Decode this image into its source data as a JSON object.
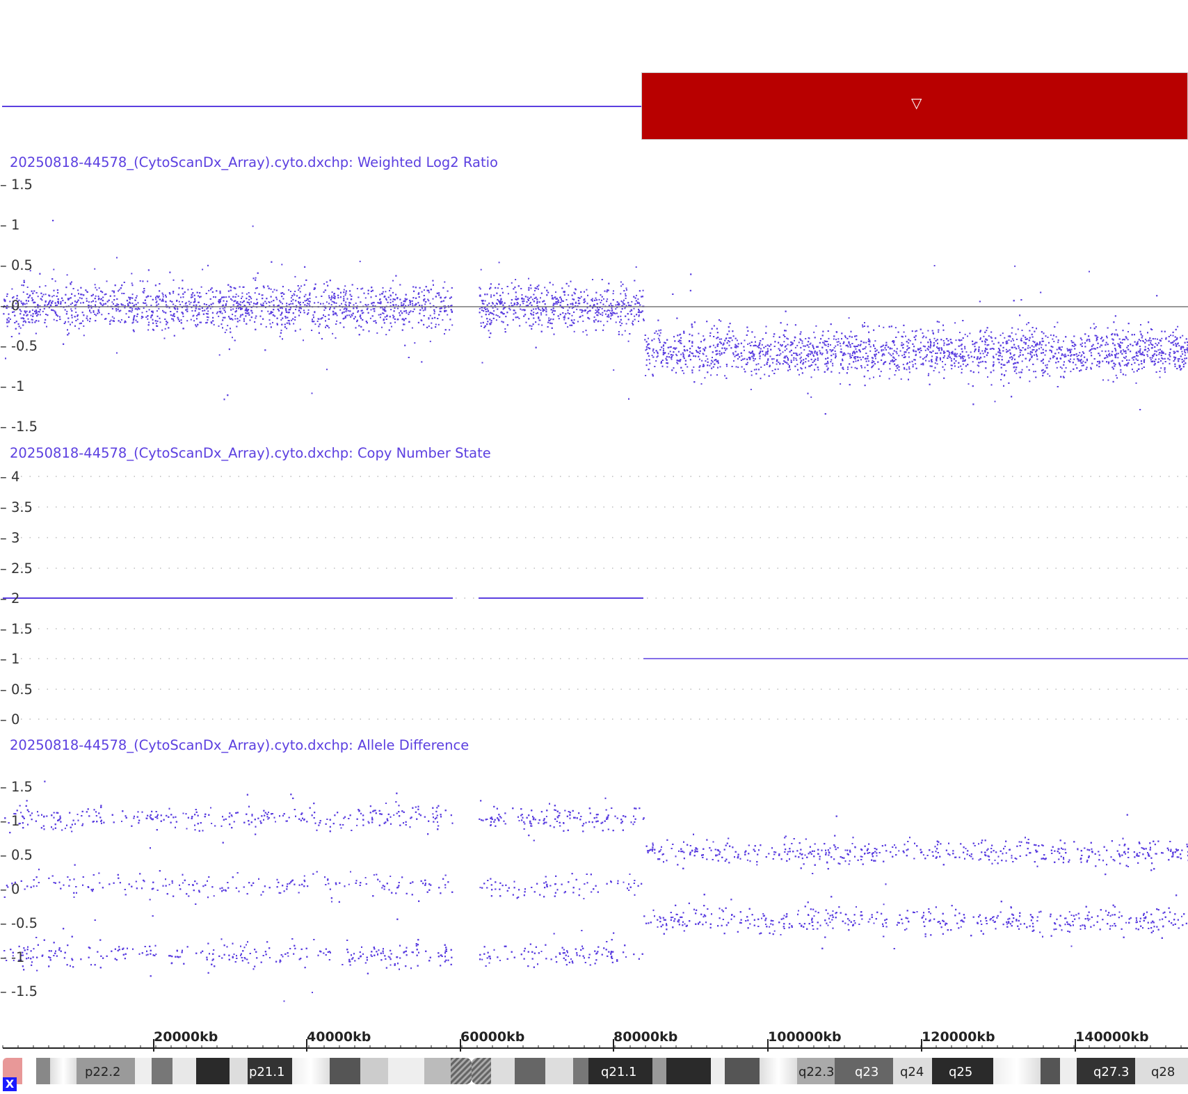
{
  "tracks": {
    "log2": {
      "title": "20250818-44578_(CytoScanDx_Array).cyto.dxchp: Weighted Log2 Ratio",
      "ticks": [
        "1.5",
        "1",
        "0.5",
        "0",
        "-0.5",
        "-1",
        "-1.5"
      ]
    },
    "cn": {
      "title": "20250818-44578_(CytoScanDx_Array).cyto.dxchp: Copy Number State",
      "ticks": [
        "4",
        "3.5",
        "3",
        "2.5",
        "2",
        "1.5",
        "1",
        "0.5",
        "0"
      ]
    },
    "allele": {
      "title": "20250818-44578_(CytoScanDx_Array).cyto.dxchp: Allele Difference",
      "ticks": [
        "1.5",
        "1",
        "0.5",
        "0",
        "-0.5",
        "-1",
        "-1.5"
      ]
    }
  },
  "ruler": {
    "labels": [
      "20000kb",
      "40000kb",
      "60000kb",
      "80000kb",
      "100000kb",
      "120000kb",
      "140000kb"
    ]
  },
  "ideogram": {
    "bands": [
      "p22.2",
      "p21.1",
      "q21.1",
      "q22.3",
      "q23",
      "q24",
      "q25",
      "q27.3",
      "q28"
    ]
  },
  "colors": {
    "data": "#5b3fe0",
    "loss": "#b80000"
  },
  "icons": {
    "cnv_marker": "triangle-down-icon",
    "close": "close-icon"
  },
  "close_label": "X",
  "marker_glyph": "▽"
}
